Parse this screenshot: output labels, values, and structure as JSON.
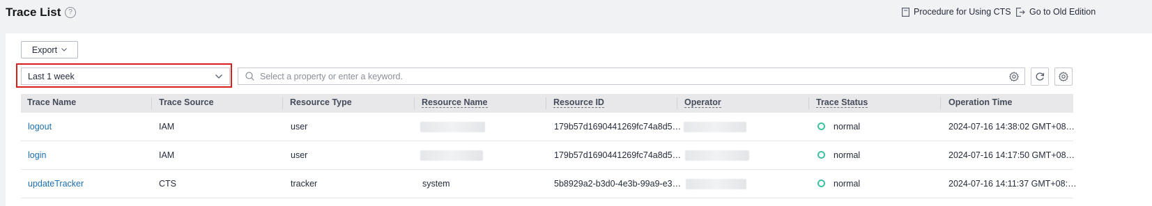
{
  "header": {
    "title": "Trace List",
    "help_icon": "question-circle-icon",
    "links": {
      "procedure": "Procedure for Using CTS",
      "old_edition": "Go to Old Edition"
    }
  },
  "toolbar": {
    "export_label": "Export",
    "time_range": "Last 1 week",
    "search_placeholder": "Select a property or enter a keyword."
  },
  "table": {
    "columns": [
      "Trace Name",
      "Trace Source",
      "Resource Type",
      "Resource Name",
      "Resource ID",
      "Operator",
      "Trace Status",
      "Operation Time"
    ],
    "rows": [
      {
        "trace_name": "logout",
        "trace_source": "IAM",
        "resource_type": "user",
        "resource_name": "",
        "resource_id": "179b57d1690441269fc74a8d5…",
        "operator": "",
        "trace_status": "normal",
        "operation_time": "2024-07-16 14:38:02 GMT+08…"
      },
      {
        "trace_name": "login",
        "trace_source": "IAM",
        "resource_type": "user",
        "resource_name": "",
        "resource_id": "179b57d1690441269fc74a8d5…",
        "operator": "",
        "trace_status": "normal",
        "operation_time": "2024-07-16 14:17:50 GMT+08…"
      },
      {
        "trace_name": "updateTracker",
        "trace_source": "CTS",
        "resource_type": "tracker",
        "resource_name": "system",
        "resource_id": "5b8929a2-b3d0-4e3b-99a9-e3…",
        "operator": "",
        "trace_status": "normal",
        "operation_time": "2024-07-16 14:11:37 GMT+08:…"
      }
    ]
  },
  "colors": {
    "link": "#1a6eb0",
    "status_normal": "#3fc0a0",
    "highlight": "#d81e1e"
  }
}
